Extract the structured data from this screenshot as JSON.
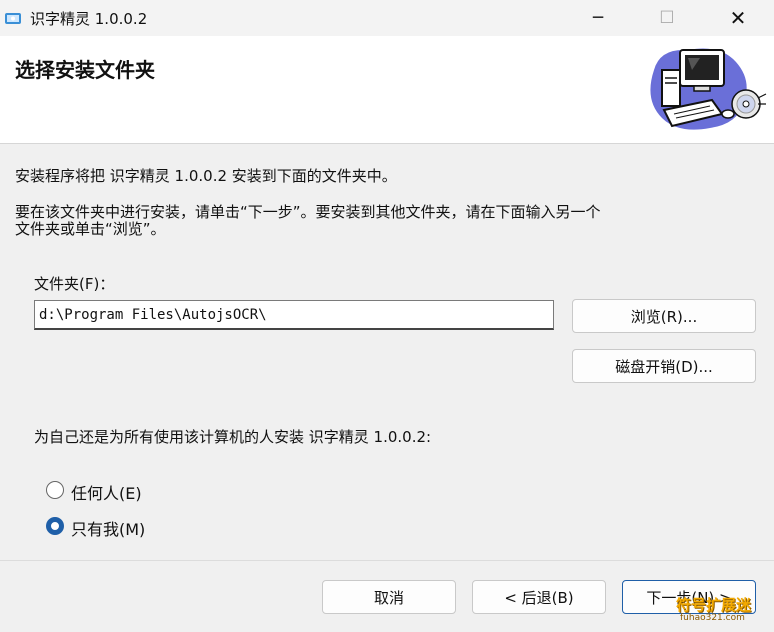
{
  "window": {
    "title": "识字精灵 1.0.0.2",
    "minimize_glyph": "─",
    "maximize_glyph": "☐",
    "close_glyph": "✕"
  },
  "header": {
    "title": "选择安装文件夹",
    "art_icon": "computer-cd-icon"
  },
  "body": {
    "line1": "安装程序将把 识字精灵 1.0.0.2 安装到下面的文件夹中。",
    "line2": "要在该文件夹中进行安装，请单击“下一步”。要安装到其他文件夹，请在下面输入另一个",
    "line3": "文件夹或单击“浏览”。",
    "folder_label": "文件夹(F)：",
    "folder_value": "d:\\Program Files\\AutojsOCR\\",
    "browse_button": "浏览(R)...",
    "disk_cost_button": "磁盘开销(D)...",
    "install_for_question": "为自己还是为所有使用该计算机的人安装 识字精灵 1.0.0.2:",
    "option_everyone": "任何人(E)",
    "option_just_me": "只有我(M)",
    "selected_option": "just_me"
  },
  "footer": {
    "cancel_button": "取消",
    "back_button": "< 后退(B)",
    "next_button": "下一步(N) >"
  },
  "watermark": {
    "text": "符号扩展迷",
    "url": "fuhao321.com"
  }
}
